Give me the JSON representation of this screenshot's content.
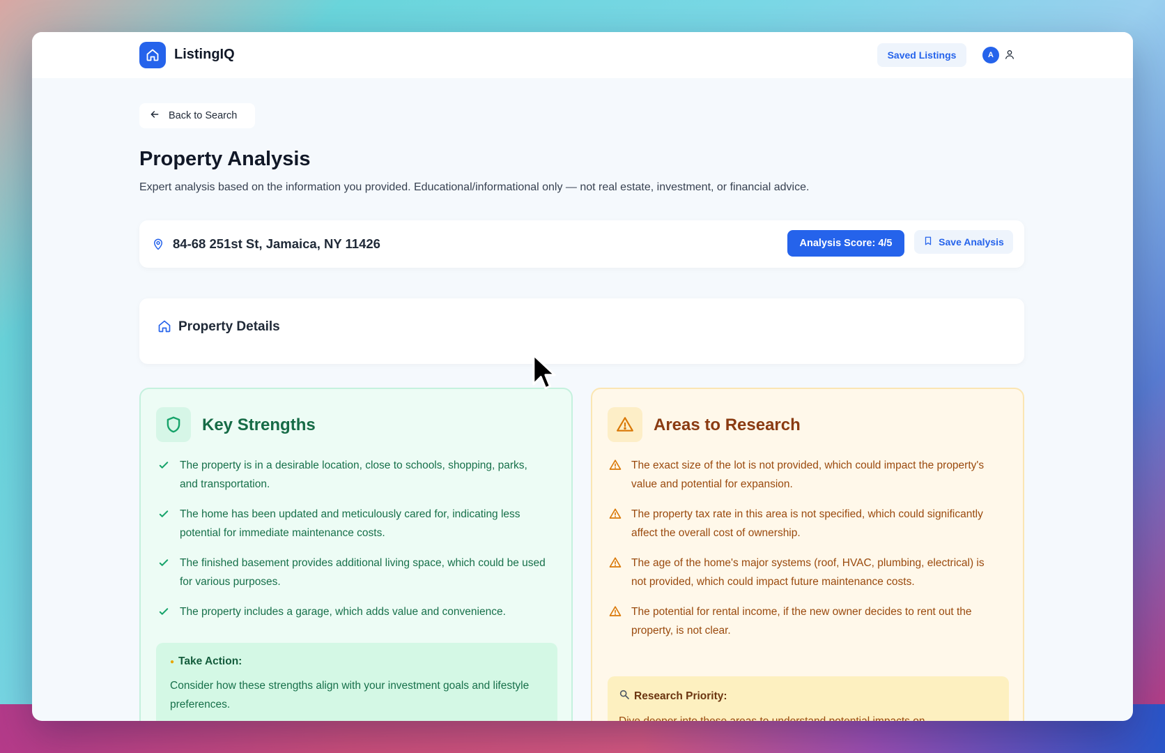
{
  "header": {
    "brand": "ListingIQ",
    "saved_listings": "Saved Listings",
    "avatar_initial": "A"
  },
  "nav": {
    "back_label": "Back to Search"
  },
  "page": {
    "title": "Property Analysis",
    "subtitle": "Expert analysis based on the information you provided. Educational/informational only — not real estate, investment, or financial advice."
  },
  "property": {
    "address": "84-68 251st St, Jamaica, NY 11426",
    "score_label": "Analysis Score: 4/5",
    "save_label": "Save Analysis"
  },
  "details": {
    "title": "Property Details"
  },
  "strengths": {
    "title": "Key Strengths",
    "items": [
      "The property is in a desirable location, close to schools, shopping, parks, and transportation.",
      "The home has been updated and meticulously cared for, indicating less potential for immediate maintenance costs.",
      "The finished basement provides additional living space, which could be used for various purposes.",
      "The property includes a garage, which adds value and convenience."
    ],
    "action_title": "Take Action:",
    "action_body": "Consider how these strengths align with your investment goals and lifestyle preferences."
  },
  "research": {
    "title": "Areas to Research",
    "items": [
      "The exact size of the lot is not provided, which could impact the property's value and potential for expansion.",
      "The property tax rate in this area is not specified, which could significantly affect the overall cost of ownership.",
      "The age of the home's major systems (roof, HVAC, plumbing, electrical) is not provided, which could impact future maintenance costs.",
      "The potential for rental income, if the new owner decides to rent out the property, is not clear."
    ],
    "priority_title": "Research Priority:",
    "priority_body": "Dive deeper into these areas to understand potential impacts on"
  },
  "colors": {
    "accent": "#2563eb",
    "strength_text": "#17704a",
    "research_text": "#9a4a0e"
  }
}
